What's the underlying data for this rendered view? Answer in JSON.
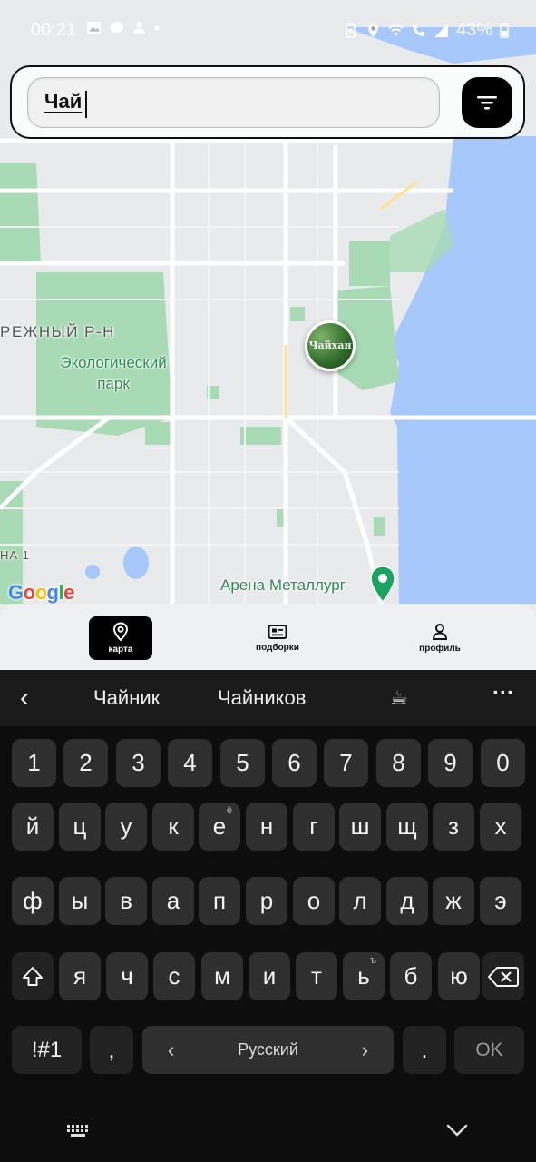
{
  "status_bar": {
    "time": "00:21",
    "battery": "43%"
  },
  "search": {
    "value": "Чай"
  },
  "map": {
    "district_label": "РЕЖНЫЙ Р-Н",
    "park_label_line1": "Экологический",
    "park_label_line2": "парк",
    "district2_label": "НА 1",
    "arena_label": "Арена Металлург",
    "marker_text": "Чайхан",
    "google_logo": [
      "G",
      "o",
      "o",
      "g",
      "l",
      "e"
    ],
    "colors": {
      "water": "#a6c8fa",
      "park": "#a8dab5",
      "road": "#ffffff",
      "land": "#e9eaec"
    }
  },
  "bottom_nav": {
    "items": [
      {
        "label": "карта",
        "icon": "map-pin-icon",
        "active": true
      },
      {
        "label": "подборки",
        "icon": "newspaper-icon",
        "active": false
      },
      {
        "label": "профиль",
        "icon": "user-icon",
        "active": false
      }
    ]
  },
  "keyboard": {
    "suggestions": [
      "Чайник",
      "Чайников",
      "☕"
    ],
    "more": "···",
    "back": "‹",
    "row_numbers": [
      "1",
      "2",
      "3",
      "4",
      "5",
      "6",
      "7",
      "8",
      "9",
      "0"
    ],
    "row1": [
      "й",
      "ц",
      "у",
      "к",
      "е",
      "н",
      "г",
      "ш",
      "щ",
      "з",
      "х"
    ],
    "row1_super": {
      "4": "ё"
    },
    "row2": [
      "ф",
      "ы",
      "в",
      "а",
      "п",
      "р",
      "о",
      "л",
      "д",
      "ж",
      "э"
    ],
    "row3": [
      "я",
      "ч",
      "с",
      "м",
      "и",
      "т",
      "ь",
      "б",
      "ю"
    ],
    "row3_super": {
      "6": "ъ"
    },
    "symbols_key": "!#1",
    "comma_key": ",",
    "space_label": "Русский",
    "period_key": ".",
    "ok_key": "OK"
  }
}
